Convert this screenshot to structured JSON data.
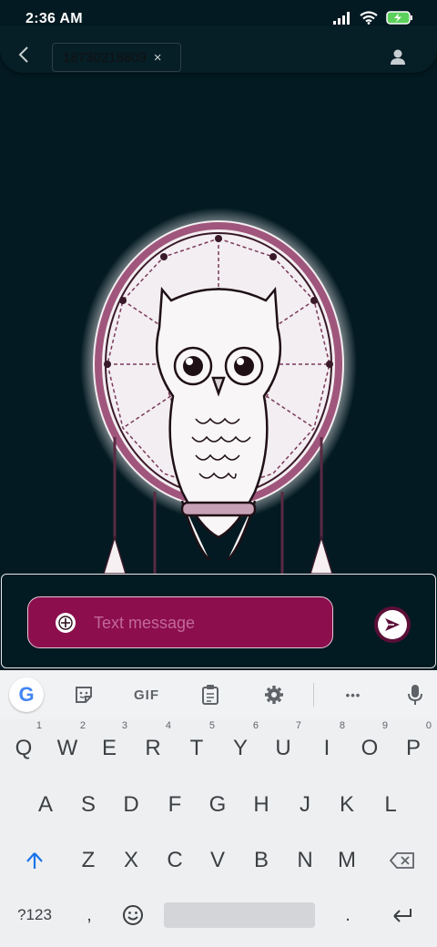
{
  "status_bar": {
    "time": "2:36 AM",
    "icons": [
      "signal-icon",
      "wifi-icon",
      "battery-charging-icon"
    ],
    "battery_color": "#5bd05b"
  },
  "header": {
    "recipient": "18730218809",
    "chip_close": "×"
  },
  "compose": {
    "placeholder": "Text message",
    "field_color": "#8c0e4d"
  },
  "keyboard": {
    "toolbar": {
      "google_label": "G",
      "gif_label": "GIF",
      "more_label": "•••"
    },
    "row1": [
      {
        "key": "Q",
        "hint": "1"
      },
      {
        "key": "W",
        "hint": "2"
      },
      {
        "key": "E",
        "hint": "3"
      },
      {
        "key": "R",
        "hint": "4"
      },
      {
        "key": "T",
        "hint": "5"
      },
      {
        "key": "Y",
        "hint": "6"
      },
      {
        "key": "U",
        "hint": "7"
      },
      {
        "key": "I",
        "hint": "8"
      },
      {
        "key": "O",
        "hint": "9"
      },
      {
        "key": "P",
        "hint": "0"
      }
    ],
    "row2": [
      "A",
      "S",
      "D",
      "F",
      "G",
      "H",
      "J",
      "K",
      "L"
    ],
    "row3": [
      "Z",
      "X",
      "C",
      "V",
      "B",
      "N",
      "M"
    ],
    "row4": {
      "symbols": "?123",
      "comma": ",",
      "period": "."
    }
  }
}
